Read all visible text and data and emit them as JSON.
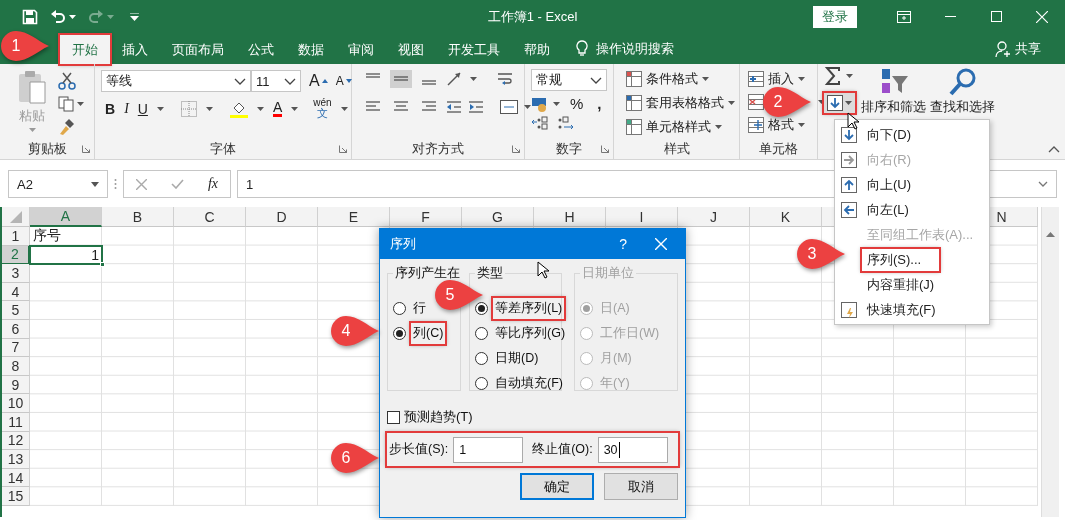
{
  "title_bar": {
    "title": "工作簿1  -  Excel",
    "login": "登录"
  },
  "tabs": [
    {
      "label": "开始",
      "selected": true,
      "highlighted": true
    },
    {
      "label": "插入",
      "selected": false,
      "highlighted": false
    },
    {
      "label": "页面布局",
      "selected": false,
      "highlighted": false
    },
    {
      "label": "公式",
      "selected": false,
      "highlighted": false
    },
    {
      "label": "数据",
      "selected": false,
      "highlighted": false
    },
    {
      "label": "审阅",
      "selected": false,
      "highlighted": false
    },
    {
      "label": "视图",
      "selected": false,
      "highlighted": false
    },
    {
      "label": "开发工具",
      "selected": false,
      "highlighted": false
    },
    {
      "label": "帮助",
      "selected": false,
      "highlighted": false
    }
  ],
  "tell_me": "操作说明搜索",
  "share": "共享",
  "ribbon": {
    "clipboard": {
      "paste": "粘贴",
      "label": "剪贴板"
    },
    "font": {
      "name": "等线",
      "size": "11",
      "grow": "A",
      "shrink": "A",
      "styles": [
        "B",
        "I",
        "U"
      ],
      "color_letter": "A",
      "phonetic": [
        "wén",
        "文"
      ],
      "label": "字体"
    },
    "alignment": {
      "label": "对齐方式"
    },
    "number": {
      "format": "常规",
      "percent": "%",
      "comma": ",",
      "label": "数字"
    },
    "styles": {
      "items": [
        "条件格式",
        "套用表格格式",
        "单元格样式"
      ],
      "label": "样式"
    },
    "cells": {
      "items": [
        {
          "kind": "insert",
          "label": "插入"
        },
        {
          "kind": "delete"
        },
        {
          "kind": "format",
          "label": "格式"
        }
      ],
      "label": "单元格"
    },
    "editing": {
      "fill_highlighted": true,
      "sort": "排序和筛选",
      "find": "查找和选择"
    }
  },
  "formula_bar": {
    "name_box": "A2",
    "function_label": "fx",
    "formula": "1"
  },
  "sheet": {
    "columns": [
      {
        "label": "A",
        "selected": true
      },
      {
        "label": "B",
        "selected": false
      },
      {
        "label": "C",
        "selected": false
      },
      {
        "label": "D",
        "selected": false
      },
      {
        "label": "E",
        "selected": false
      },
      {
        "label": "F",
        "selected": false
      },
      {
        "label": "G",
        "selected": false
      },
      {
        "label": "H",
        "selected": false
      },
      {
        "label": "I",
        "selected": false
      },
      {
        "label": "J",
        "selected": false
      },
      {
        "label": "K",
        "selected": false
      },
      {
        "kind": "covered"
      },
      {
        "kind": "hidden"
      },
      {
        "label": "N",
        "selected": false
      }
    ],
    "rows": [
      {
        "label": "1",
        "selected": false,
        "cells": [
          {
            "kind": "text",
            "value": "序号",
            "selected": false
          }
        ]
      },
      {
        "label": "2",
        "selected": true,
        "cells": [
          {
            "kind": "number",
            "value": "1",
            "selected": true
          }
        ]
      },
      {
        "label": "3",
        "selected": false
      },
      {
        "label": "4",
        "selected": false
      },
      {
        "label": "5",
        "selected": false
      },
      {
        "label": "6",
        "selected": false
      },
      {
        "label": "7",
        "selected": false
      },
      {
        "label": "8",
        "selected": false
      },
      {
        "label": "9",
        "selected": false
      },
      {
        "label": "10",
        "selected": false
      },
      {
        "label": "11",
        "selected": false
      },
      {
        "label": "12",
        "selected": false
      },
      {
        "label": "13",
        "selected": false
      },
      {
        "label": "14",
        "selected": false
      },
      {
        "label": "15",
        "selected": false
      }
    ]
  },
  "fill_menu": {
    "items": [
      {
        "label": "向下(D)",
        "kind": "down",
        "disabled": false,
        "highlighted": false
      },
      {
        "label": "向右(R)",
        "kind": "right",
        "disabled": true,
        "highlighted": false
      },
      {
        "label": "向上(U)",
        "kind": "up",
        "disabled": false,
        "highlighted": false
      },
      {
        "label": "向左(L)",
        "kind": "left",
        "disabled": false,
        "highlighted": false
      },
      {
        "label": "至同组工作表(A)...",
        "kind": "plain",
        "disabled": true,
        "highlighted": false
      },
      {
        "label": "序列(S)...",
        "kind": "plain",
        "disabled": false,
        "highlighted": true
      },
      {
        "label": "内容重排(J)",
        "kind": "plain",
        "disabled": false,
        "highlighted": false
      },
      {
        "label": "快速填充(F)",
        "kind": "flash",
        "disabled": false,
        "highlighted": false
      }
    ]
  },
  "dialog": {
    "title": "序列",
    "help": "?",
    "groups": [
      {
        "label": "序列产生在",
        "disabled": false,
        "options": [
          {
            "label": "行",
            "selected": false,
            "highlighted": false
          },
          {
            "label": "列(C)",
            "selected": true,
            "highlighted": true
          }
        ]
      },
      {
        "label": "类型",
        "disabled": false,
        "options": [
          {
            "label": "等差序列(L)",
            "selected": true,
            "highlighted": true
          },
          {
            "label": "等比序列(G)",
            "selected": false,
            "highlighted": false
          },
          {
            "label": "日期(D)",
            "selected": false,
            "highlighted": false
          },
          {
            "label": "自动填充(F)",
            "selected": false,
            "highlighted": false
          }
        ]
      },
      {
        "label": "日期单位",
        "disabled": true,
        "options": [
          {
            "label": "日(A)",
            "selected": true,
            "highlighted": false
          },
          {
            "label": "工作日(W)",
            "selected": false,
            "highlighted": false
          },
          {
            "label": "月(M)",
            "selected": false,
            "highlighted": false
          },
          {
            "label": "年(Y)",
            "selected": false,
            "highlighted": false
          }
        ]
      }
    ],
    "trend": {
      "label": "预测趋势(T)",
      "checked": false
    },
    "step": {
      "label": "步长值(S):",
      "value": "1"
    },
    "stop": {
      "label": "终止值(O):",
      "value": "30"
    },
    "values_highlighted": true,
    "buttons": [
      {
        "label": "确定",
        "default": true
      },
      {
        "label": "取消",
        "default": false
      }
    ]
  },
  "callouts": [
    "1",
    "2",
    "3",
    "4",
    "5",
    "6"
  ]
}
